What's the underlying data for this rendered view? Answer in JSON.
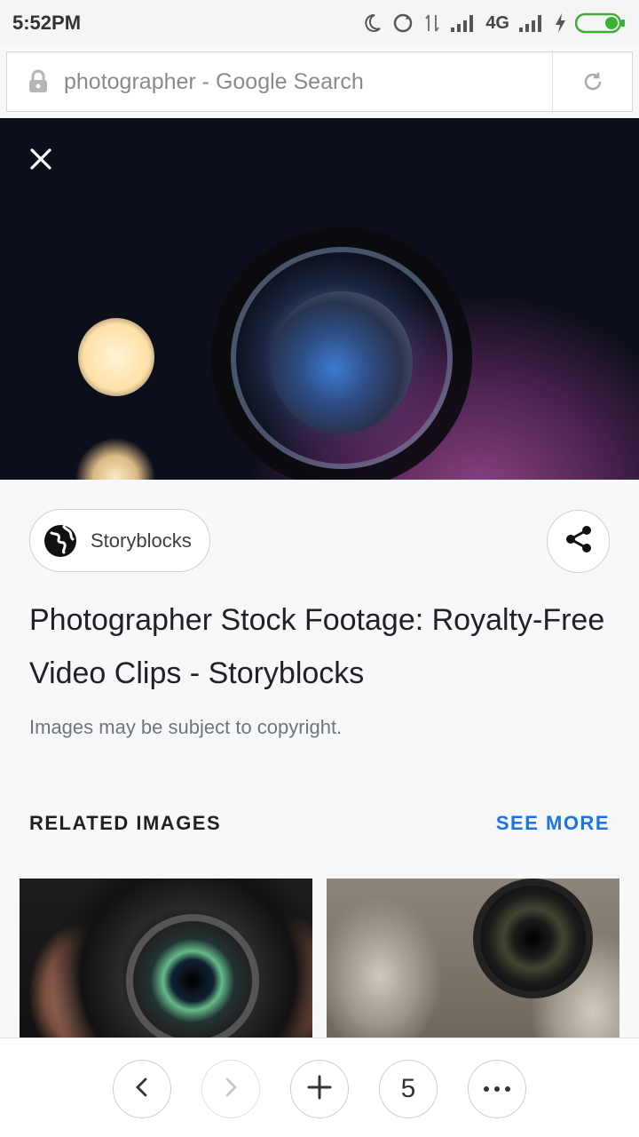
{
  "status_bar": {
    "time": "5:52PM",
    "network": "4G",
    "icons": [
      "moon-icon",
      "sync-icon",
      "data-arrows-icon",
      "signal-icon",
      "signal-icon",
      "charging-icon",
      "battery-icon"
    ]
  },
  "url_bar": {
    "text": "photographer - Google Search",
    "icons": [
      "lock-icon",
      "reload-icon"
    ]
  },
  "image_viewer": {
    "close_icon": "close-icon",
    "source": {
      "name": "Storyblocks",
      "icon": "globe-icon"
    },
    "share_icon": "share-icon",
    "title": "Photographer Stock Footage: Royalty-Free Video Clips - Storyblocks",
    "copyright_notice": "Images may be subject to copyright."
  },
  "related": {
    "header": "RELATED IMAGES",
    "see_more": "SEE MORE"
  },
  "bottom_nav": {
    "tab_count": "5",
    "icons": [
      "chevron-left-icon",
      "chevron-right-icon",
      "plus-icon",
      "more-dots-icon"
    ]
  },
  "colors": {
    "accent": "#1a73e8",
    "battery": "#3cb034"
  }
}
